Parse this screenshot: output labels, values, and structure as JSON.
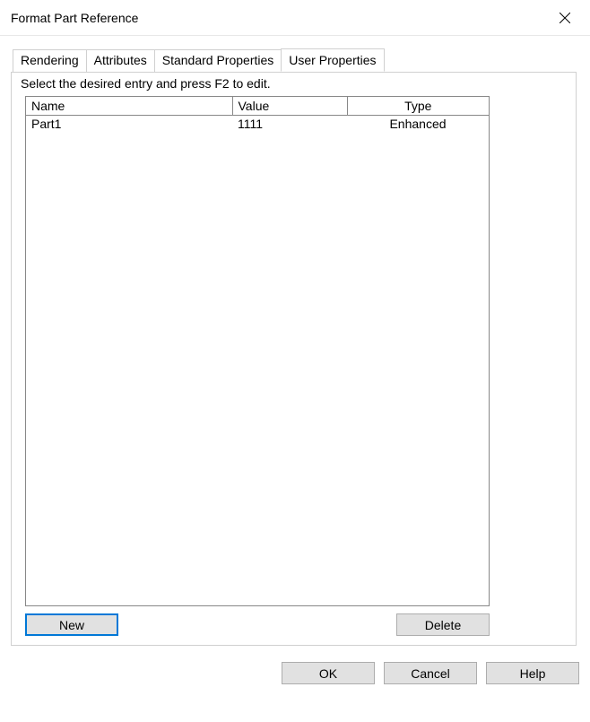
{
  "window": {
    "title": "Format Part Reference"
  },
  "tabs": {
    "items": [
      {
        "label": "Rendering"
      },
      {
        "label": "Attributes"
      },
      {
        "label": "Standard Properties"
      },
      {
        "label": "User Properties"
      }
    ],
    "activeIndex": 3
  },
  "panel": {
    "instruction": "Select the desired entry and press F2 to edit.",
    "headers": {
      "name": "Name",
      "value": "Value",
      "type": "Type"
    },
    "rows": [
      {
        "name": "Part1",
        "value": "1111",
        "type": "Enhanced"
      }
    ],
    "buttons": {
      "new": "New",
      "delete": "Delete"
    }
  },
  "dialogButtons": {
    "ok": "OK",
    "cancel": "Cancel",
    "help": "Help"
  }
}
